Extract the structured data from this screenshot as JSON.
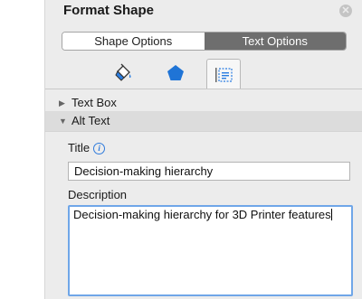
{
  "pane": {
    "title": "Format Shape",
    "close_icon": "close-icon"
  },
  "segmented": {
    "options": [
      "Shape Options",
      "Text Options"
    ],
    "selected": "Text Options"
  },
  "icon_tabs": [
    {
      "icon": "fill-bucket-icon",
      "selected": false
    },
    {
      "icon": "pentagon-effects-icon",
      "selected": false
    },
    {
      "icon": "text-box-layout-icon",
      "selected": true
    }
  ],
  "sections": {
    "text_box": {
      "label": "Text Box",
      "expanded": false
    },
    "alt_text": {
      "label": "Alt Text",
      "expanded": true
    }
  },
  "alt_text": {
    "title_label": "Title",
    "title_info_icon": "info-icon",
    "title_value": "Decision-making hierarchy",
    "description_label": "Description",
    "description_value": "Decision-making hierarchy for 3D Printer features"
  },
  "colors": {
    "pane_bg": "#ececec",
    "active_segment": "#6e6e6e",
    "focus_ring": "#6fa6e8",
    "accent_blue": "#1f74d6"
  }
}
